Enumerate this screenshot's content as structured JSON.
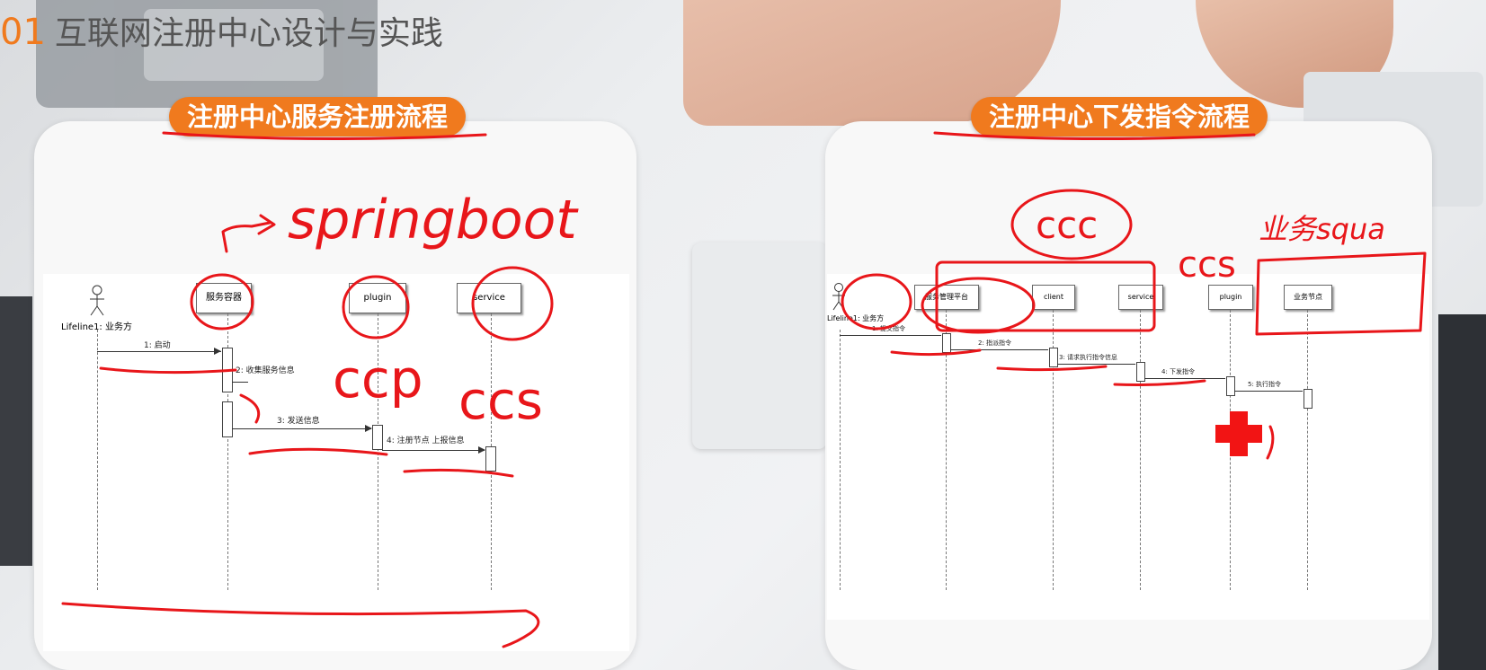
{
  "header": {
    "number": "01",
    "title": "互联网注册中心设计与实践"
  },
  "left_panel": {
    "pill": "注册中心服务注册流程",
    "actor_label": "Lifeline1: 业务方",
    "lifelines": [
      "服务容器",
      "plugin",
      "service"
    ],
    "messages": [
      "1: 启动",
      "2: 收集服务信息",
      "3: 发送信息",
      "4: 注册节点 上报信息"
    ],
    "annotations": [
      "springboot",
      "ccp",
      "ccs"
    ]
  },
  "right_panel": {
    "pill": "注册中心下发指令流程",
    "actor_label": "Lifeline1: 业务方",
    "lifelines": [
      "服务管理平台",
      "client",
      "service",
      "plugin",
      "业务节点"
    ],
    "messages": [
      "1: 提交指令",
      "2: 指派指令",
      "3: 请求执行指令信息",
      "4: 下发指令",
      "5: 执行指令"
    ],
    "annotations": [
      "ccc",
      "ccs",
      "业务squa"
    ]
  },
  "colors": {
    "accent": "#f07a1e",
    "ink": "#e8161a"
  }
}
